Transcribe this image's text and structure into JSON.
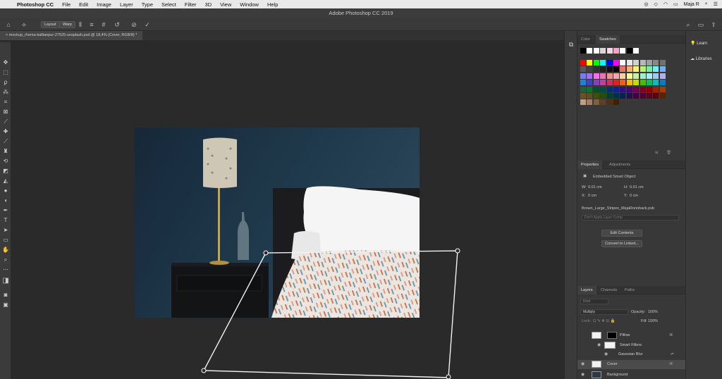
{
  "menubar": {
    "app_name": "Photoshop CC",
    "items": [
      "File",
      "Edit",
      "Image",
      "Layer",
      "Type",
      "Select",
      "Filter",
      "3D",
      "View",
      "Window",
      "Help"
    ],
    "user": "Maja R"
  },
  "window": {
    "title": "Adobe Photoshop CC 2019"
  },
  "options": {
    "layout_label": "Layout",
    "warp_label": "Warp"
  },
  "document": {
    "tab_title": "mockup_rhema-kallianpur-27525-unsplash.psd @ 18,4% (Cover, RGB/8) *"
  },
  "swatches_panel": {
    "tabs": [
      "Color",
      "Swatches"
    ],
    "active_tab": "Swatches",
    "top_row": [
      "#000000",
      "#ffffff",
      "#ffffff",
      "#d8d8d8",
      "#f7d6e6",
      "#f2a6c6",
      "#ffffff",
      "#000000",
      "#ffffff"
    ],
    "rows": [
      [
        "#ff0000",
        "#ffff00",
        "#00ff00",
        "#00ffff",
        "#0000ff",
        "#ff00ff",
        "#ffffff",
        "#e8e8e8",
        "#d0d0d0",
        "#b8b8b8",
        "#a0a0a0",
        "#888888",
        "#707070"
      ],
      [
        "#585858",
        "#404040",
        "#303030",
        "#202020",
        "#101010",
        "#000000",
        "#f07070",
        "#f8b070",
        "#f8f070",
        "#b8f070",
        "#70f0a0",
        "#70f0f0",
        "#70b0f0"
      ],
      [
        "#7080f0",
        "#a070f0",
        "#f070f0",
        "#f070b0",
        "#f09090",
        "#f0a8a8",
        "#f8d0a0",
        "#f8f8a0",
        "#c8f0a0",
        "#a0f0c8",
        "#a0f0f0",
        "#a0c8f0",
        "#b0b0f0"
      ],
      [
        "#2080e0",
        "#4040c0",
        "#8040c0",
        "#c040a0",
        "#d03060",
        "#e02020",
        "#f06010",
        "#f0c000",
        "#c0e000",
        "#40c000",
        "#00c060",
        "#00c0c0",
        "#0080c0"
      ],
      [
        "#206040",
        "#107030",
        "#005020",
        "#004848",
        "#003070",
        "#102090",
        "#301080",
        "#500070",
        "#700050",
        "#800020",
        "#900000",
        "#a02000",
        "#a04000"
      ],
      [
        "#705020",
        "#605020",
        "#405000",
        "#205000",
        "#004030",
        "#003048",
        "#002060",
        "#201050",
        "#400040",
        "#500030",
        "#600020",
        "#600000",
        "#602000"
      ],
      [
        "#c0a080",
        "#a08060",
        "#806040",
        "#604020",
        "#503010",
        "#402000"
      ]
    ]
  },
  "properties_panel": {
    "tabs": [
      "Properties",
      "Adjustments"
    ],
    "active_tab": "Properties",
    "object_type": "Embedded Smart Object",
    "w_label": "W:",
    "w_value": "0.01 cm",
    "h_label": "H:",
    "h_value": "0.01 cm",
    "x_label": "X:",
    "x_value": "0 cm",
    "y_label": "Y:",
    "y_value": "0 cm",
    "filename": "Brown_Large_Stripes_MajaRonnback.psb",
    "layer_comp_placeholder": "Don't Apply Layer Comp",
    "edit_contents": "Edit Contents",
    "convert_linked": "Convert to Linked..."
  },
  "layers_panel": {
    "tabs": [
      "Layers",
      "Channels",
      "Paths"
    ],
    "active_tab": "Layers",
    "kind_placeholder": "Kind",
    "blend_mode": "Multiply",
    "opacity_label": "Opacity:",
    "opacity_value": "100%",
    "lock_label": "Lock:",
    "fill_label": "Fill:",
    "fill_value": "100%",
    "layers": [
      {
        "name": "Pillow",
        "visible": false,
        "selected": false
      },
      {
        "name": "Smart Filters",
        "visible": false,
        "selected": false
      },
      {
        "name": "Gaussian Blur",
        "visible": false,
        "selected": false
      },
      {
        "name": "Cover",
        "visible": true,
        "selected": true
      },
      {
        "name": "Background",
        "visible": true,
        "selected": false
      }
    ]
  },
  "learn_panel": {
    "learn": "Learn",
    "libraries": "Libraries"
  },
  "colors": {
    "canvas": "#2a2a2a",
    "wall": "#1f3a4c",
    "lampshade": "#cfc7b6",
    "brass": "#c9a24b",
    "pillow": "#f5f5f5",
    "duvet": "#ece6e0",
    "headboard": "#1c1c1e",
    "nightstand": "#131416"
  }
}
